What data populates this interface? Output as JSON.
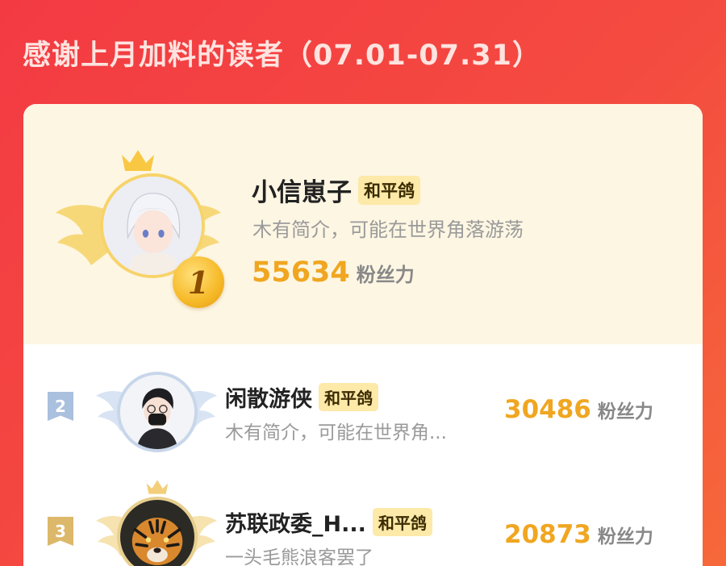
{
  "page": {
    "title": "感谢上月加料的读者（07.01-07.31）"
  },
  "score_unit": "粉丝力",
  "first": {
    "rank": "1",
    "name": "小信崽子",
    "badge": "和平鸽",
    "bio": "木有简介，可能在世界角落游荡",
    "score": "55634"
  },
  "list": [
    {
      "rank": "2",
      "name": "闲散游侠",
      "badge": "和平鸽",
      "bio": "木有简介，可能在世界角...",
      "score": "30486",
      "rank_color": "#a9c0de"
    },
    {
      "rank": "3",
      "name": "苏联政委_H...",
      "badge": "和平鸽",
      "bio": "一头毛熊浪客罢了",
      "score": "20873",
      "rank_color": "#dcb86a"
    }
  ],
  "colors": {
    "accent": "#f0a620",
    "bg_top": "#f33a43",
    "bg_bottom": "#f6683a",
    "card_top": "#fdf6e3"
  },
  "icons": {
    "crown": "crown-icon",
    "wings": "wings-icon",
    "medal": "rank-medal-icon"
  }
}
